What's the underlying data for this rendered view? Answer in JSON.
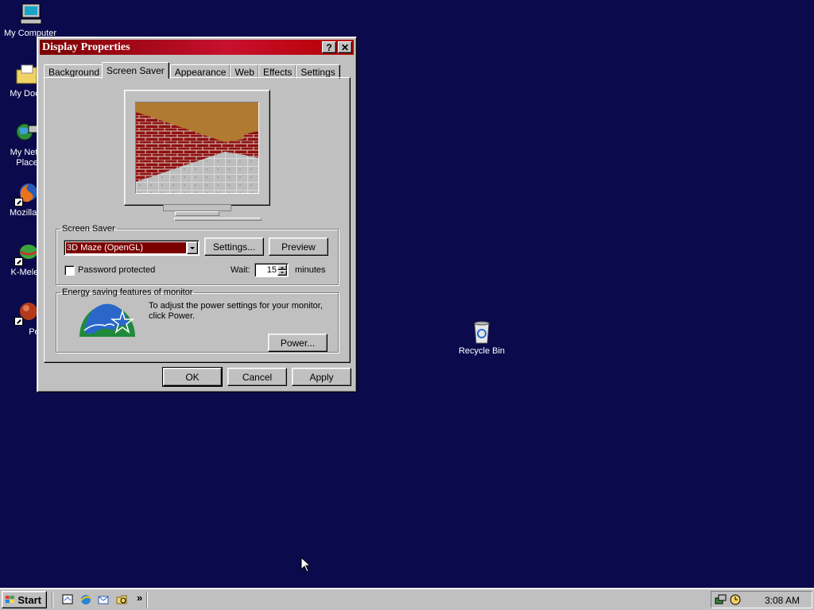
{
  "desktop": {
    "icons": [
      {
        "label": "My Computer"
      },
      {
        "label": "My Docu"
      },
      {
        "label": "My Netw",
        "label2": "Place"
      },
      {
        "label": "Mozilla F"
      },
      {
        "label": "K-Meleo"
      },
      {
        "label": "Peg"
      }
    ],
    "recycle_bin": "Recycle Bin"
  },
  "window": {
    "title": "Display Properties",
    "help_glyph": "?",
    "close_glyph": "✕",
    "tabs": [
      "Background",
      "Screen Saver",
      "Appearance",
      "Web",
      "Effects",
      "Settings"
    ],
    "active_tab": "Screen Saver",
    "screensaver": {
      "group_label": "Screen Saver",
      "selected": "3D Maze (OpenGL)",
      "settings_label": "Settings...",
      "preview_label": "Preview",
      "password_label": "Password protected",
      "password_checked": false,
      "wait_label": "Wait:",
      "wait_value": "15",
      "wait_unit": "minutes"
    },
    "energy": {
      "group_label": "Energy saving features of monitor",
      "text": "To adjust the power settings for your monitor, click Power.",
      "power_label": "Power..."
    },
    "buttons": {
      "ok": "OK",
      "cancel": "Cancel",
      "apply": "Apply"
    }
  },
  "taskbar": {
    "start_label": "Start",
    "quicklaunch_more": "»",
    "clock": "3:08 AM"
  },
  "colors": {
    "desktop": "#0b0a4c",
    "titlebar": "#c8102e",
    "selection": "#7b0000"
  }
}
